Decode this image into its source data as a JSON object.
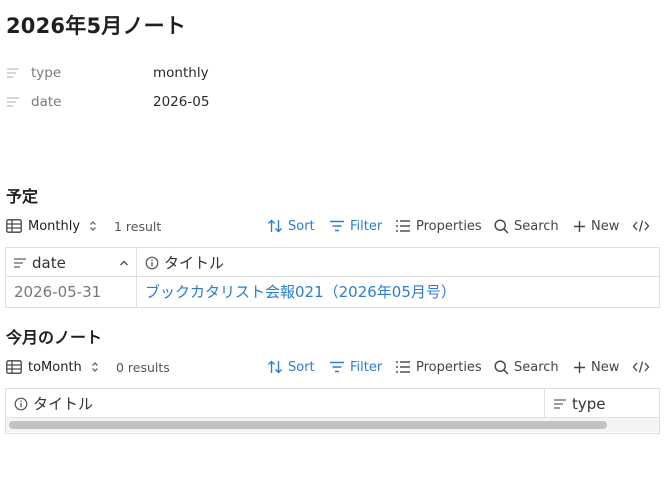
{
  "page": {
    "title": "2026年5月ノート"
  },
  "properties": [
    {
      "key": "type",
      "value": "monthly",
      "icon": "text-lines-icon"
    },
    {
      "key": "date",
      "value": "2026-05",
      "icon": "text-lines-icon"
    }
  ],
  "sections": [
    {
      "title": "予定",
      "toolbar": {
        "view_label": "Monthly",
        "result_count": "1 result",
        "sort": "Sort",
        "filter": "Filter",
        "properties": "Properties",
        "search": "Search",
        "new": "New"
      },
      "columns": [
        "date",
        "タイトル"
      ],
      "rows": [
        {
          "date": "2026-05-31",
          "title": "ブックカタリスト会報021（2026年05月号）"
        }
      ]
    },
    {
      "title": "今月のノート",
      "toolbar": {
        "view_label": "toMonth",
        "result_count": "0 results",
        "sort": "Sort",
        "filter": "Filter",
        "properties": "Properties",
        "search": "Search",
        "new": "New"
      },
      "columns": [
        "タイトル",
        "type"
      ],
      "rows": []
    }
  ],
  "colors": {
    "accent": "#2b7cd3",
    "border": "#e0e0e0",
    "muted_text": "#7a7a7a"
  }
}
